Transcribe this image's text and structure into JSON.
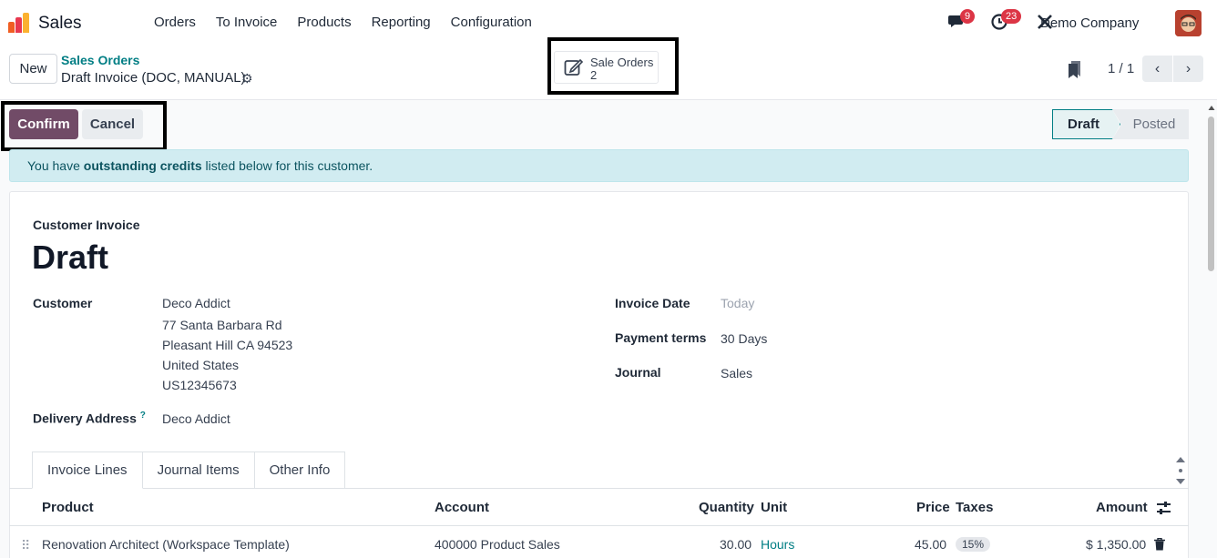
{
  "navbar": {
    "app_name": "Sales",
    "menu": [
      "Orders",
      "To Invoice",
      "Products",
      "Reporting",
      "Configuration"
    ],
    "messages_count": "9",
    "activities_count": "23",
    "company": "Demo Company"
  },
  "control_panel": {
    "new_label": "New",
    "breadcrumb_parent": "Sales Orders",
    "breadcrumb_current": "Draft Invoice (DOC, MANUAL)",
    "smart_button": {
      "label": "Sale Orders",
      "count": "2"
    },
    "pager": "1 / 1"
  },
  "actions": {
    "confirm": "Confirm",
    "cancel": "Cancel"
  },
  "statusbar": {
    "draft": "Draft",
    "posted": "Posted"
  },
  "alert": {
    "prefix": "You have ",
    "bold": "outstanding credits",
    "suffix": " listed below for this customer."
  },
  "invoice": {
    "type": "Customer Invoice",
    "title": "Draft",
    "customer_label": "Customer",
    "customer_lines": [
      "Deco Addict",
      "77 Santa Barbara Rd",
      "Pleasant Hill CA 94523",
      "United States",
      "US12345673"
    ],
    "delivery_label": "Delivery Address",
    "delivery_help": "?",
    "delivery_value": "Deco Addict",
    "invoice_date_label": "Invoice Date",
    "invoice_date_placeholder": "Today",
    "payment_terms_label": "Payment terms",
    "payment_terms_value": "30 Days",
    "journal_label": "Journal",
    "journal_value": "Sales"
  },
  "tabs": [
    "Invoice Lines",
    "Journal Items",
    "Other Info"
  ],
  "table": {
    "headers": {
      "product": "Product",
      "account": "Account",
      "quantity": "Quantity",
      "unit": "Unit",
      "price": "Price",
      "taxes": "Taxes",
      "amount": "Amount"
    },
    "rows": [
      {
        "product": "Renovation Architect (Workspace Template)",
        "account": "400000 Product Sales",
        "quantity": "30.00",
        "unit": "Hours",
        "price": "45.00",
        "taxes": "15%",
        "amount": "$ 1,350.00"
      }
    ]
  },
  "colors": {
    "primary": "#714b67",
    "link": "#017e84",
    "alert_bg": "#d1ecf1"
  },
  "icons": [
    "odoo-logo-icon",
    "chat-icon",
    "clock-icon",
    "tools-icon",
    "gear-icon",
    "edit-icon",
    "bookmark-icon",
    "chevron-left-icon",
    "chevron-right-icon",
    "settings-sliders-icon",
    "trash-icon",
    "drag-handle-icon"
  ]
}
